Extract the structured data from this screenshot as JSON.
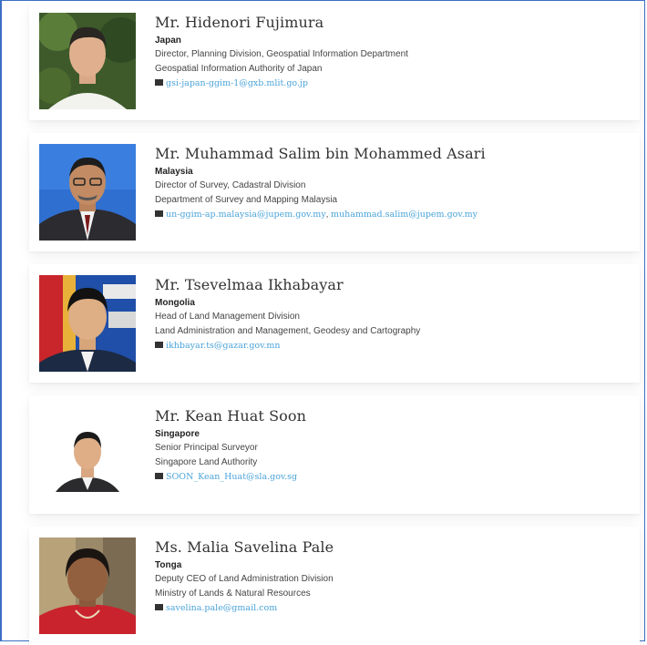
{
  "people": [
    {
      "name": "Mr. Hidenori Fujimura",
      "country": "Japan",
      "line1": "Director, Planning Division, Geospatial Information Department",
      "line2": "Geospatial Information Authority of Japan",
      "emails": [
        "gsi-japan-ggim-1@gxb.mlit.go.jp"
      ]
    },
    {
      "name": "Mr. Muhammad Salim bin Mohammed Asari",
      "country": "Malaysia",
      "line1": "Director of Survey, Cadastral Division",
      "line2": "Department of Survey and Mapping Malaysia",
      "emails": [
        "un-ggim-ap.malaysia@jupem.gov.my",
        "muhammad.salim@jupem.gov.my"
      ]
    },
    {
      "name": "Mr. Tsevelmaa Ikhabayar",
      "country": "Mongolia",
      "line1": "Head of Land Management Division",
      "line2": "Land Administration and Management, Geodesy and Cartography",
      "emails": [
        "ikhbayar.ts@gazar.gov.mn"
      ]
    },
    {
      "name": "Mr. Kean Huat Soon",
      "country": "Singapore",
      "line1": "Senior Principal Surveyor",
      "line2": "Singapore Land Authority",
      "emails": [
        "SOON_Kean_Huat@sla.gov.sg"
      ]
    },
    {
      "name": "Ms. Malia Savelina Pale",
      "country": "Tonga",
      "line1": "Deputy CEO of Land Administration Division",
      "line2": "Ministry of Lands & Natural Resources",
      "emails": [
        "savelina.pale@gmail.com"
      ]
    }
  ],
  "email_separator": ", ",
  "colors": {
    "link": "#4aa3d8",
    "frame": "#3b6fc4",
    "text": "#333333"
  },
  "icons": {
    "email": "envelope-icon"
  }
}
